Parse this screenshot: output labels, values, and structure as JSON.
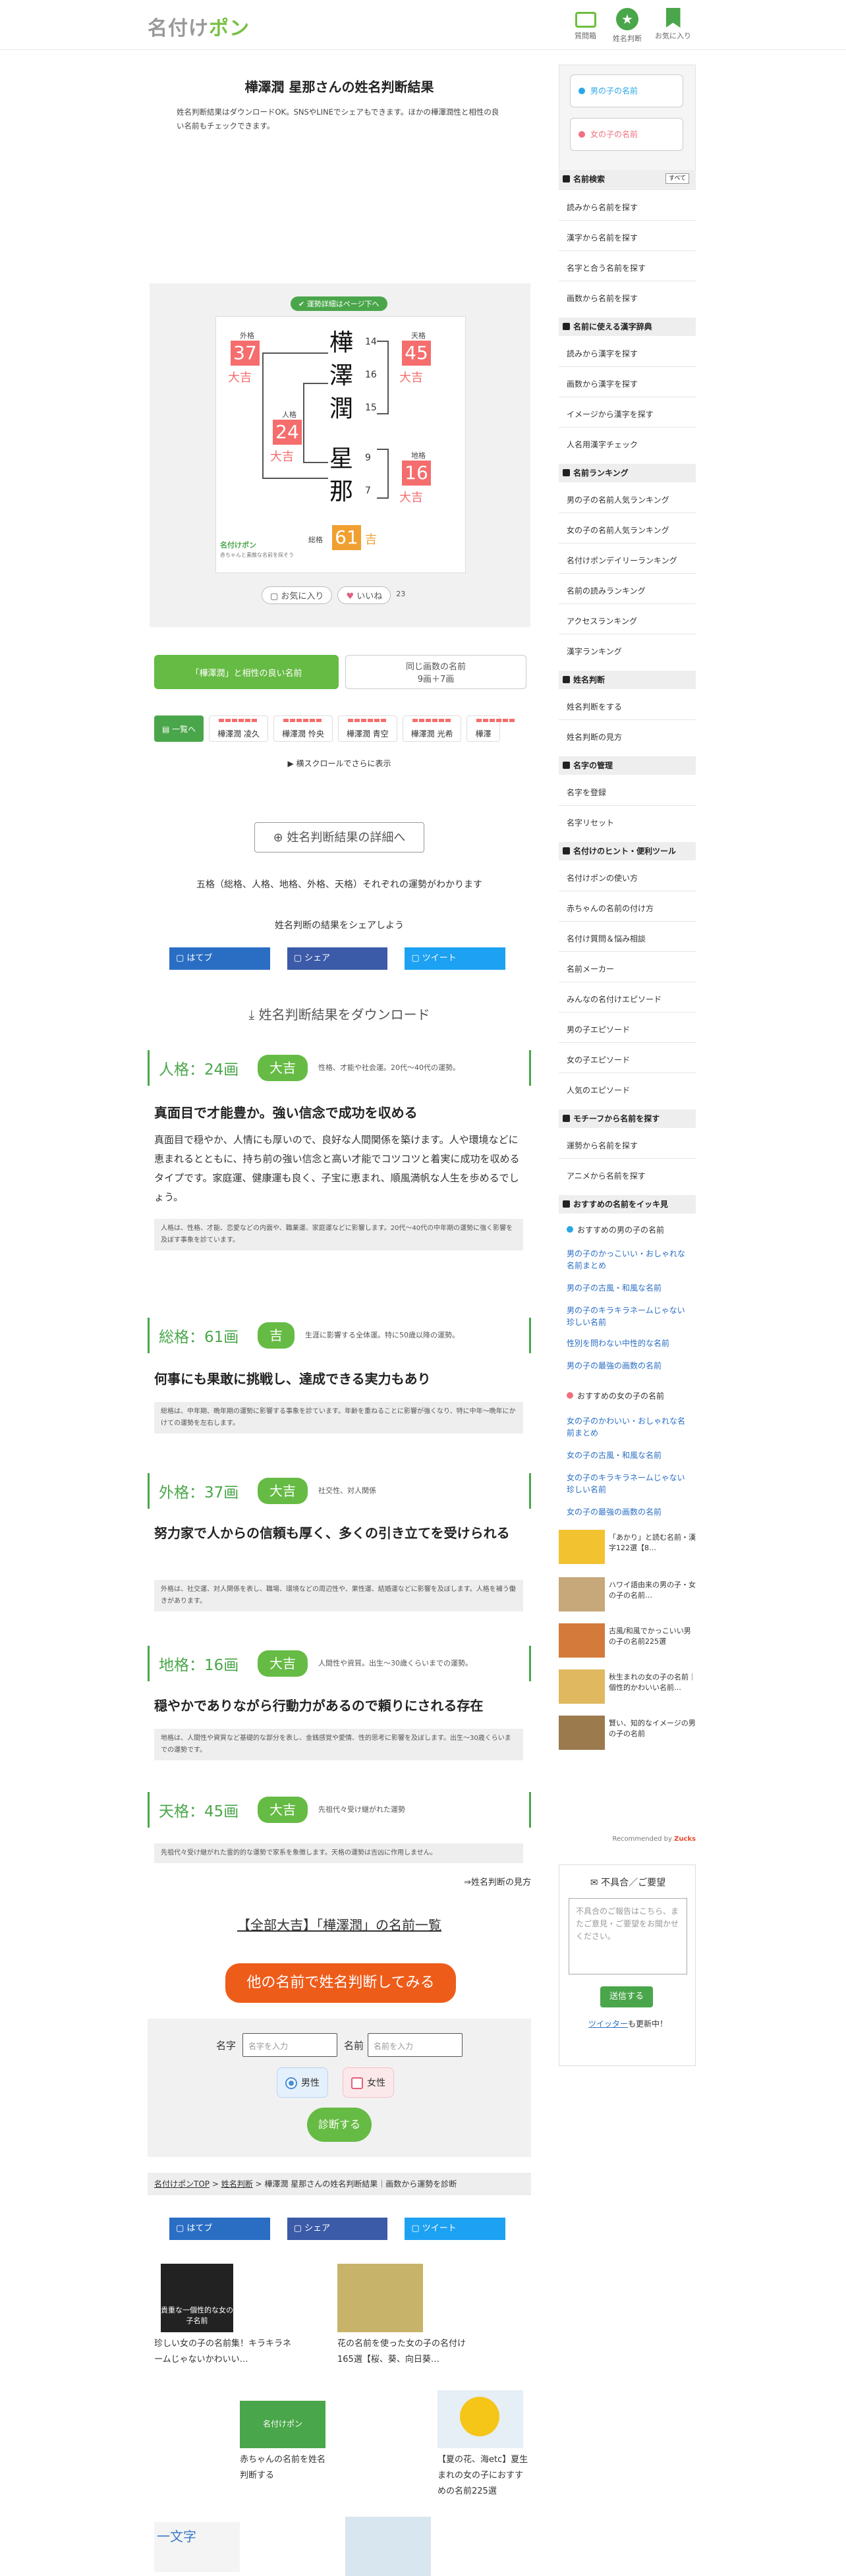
{
  "site": {
    "logo_a": "名付け",
    "logo_b": "ポン"
  },
  "header_nav": [
    {
      "label": "質問箱",
      "icon": "chat-icon",
      "color": "#6bbf3a"
    },
    {
      "label": "姓名判断",
      "icon": "star-icon",
      "color": "#4aa64a"
    },
    {
      "label": "お気に入り",
      "icon": "bookmark-icon",
      "color": "#4aa64a"
    }
  ],
  "page": {
    "title": "樺澤潤 星那さんの姓名判断結果",
    "lead": "姓名判断結果はダウンロードOK。SNSやLINEでシェアもできます。ほかの樺澤潤性と相性の良い名前もチェックできます。"
  },
  "figure": {
    "header": "運勢詳細はページ下へ",
    "surname": [
      "樺",
      "澤",
      "潤"
    ],
    "surname_strokes": [
      "14",
      "16",
      "15"
    ],
    "given": [
      "星",
      "那"
    ],
    "given_strokes": [
      "9",
      "7"
    ],
    "outer": {
      "label": "外格",
      "value": "37",
      "fortune": "大吉"
    },
    "person": {
      "label": "人格",
      "value": "24",
      "fortune": "大吉"
    },
    "heaven": {
      "label": "天格",
      "value": "45",
      "fortune": "大吉"
    },
    "earth": {
      "label": "地格",
      "value": "16",
      "fortune": "大吉"
    },
    "total": {
      "label": "総格",
      "value": "61",
      "fortune": "吉"
    },
    "brand": "名付けポン",
    "footer_small": "赤ちゃんと素敵な名前を探そう"
  },
  "actions": {
    "fav": "お気に入り",
    "like": "いいね",
    "count": "23"
  },
  "tabs": {
    "good": "「樺澤潤」と相性の良い名前",
    "same_a": "同じ画数の名前",
    "same_b": "9画＋7画"
  },
  "name_cards": {
    "first": "一覧へ",
    "items": [
      "樺澤潤 凌久",
      "樺澤潤 怜央",
      "樺澤潤 青空",
      "樺澤潤 光希",
      "樺澤"
    ]
  },
  "scroll_hint": "横スクロールでさらに表示",
  "detail_btn": "姓名判断結果の詳細へ",
  "detail_caption": "五格（総格、人格、地格、外格、天格）それぞれの運勢がわかります",
  "share_caption": "姓名判断の結果をシェアしよう",
  "share": {
    "hatena": "はてブ",
    "facebook": "シェア",
    "twitter": "ツイート"
  },
  "download": "姓名判断結果をダウンロード",
  "kaku": [
    {
      "head": "人格：24画",
      "tag": "大吉",
      "desc": "性格、才能や社会運。20代〜40代の運勢。",
      "title": "真面目で才能豊か。強い信念で成功を収める",
      "body": "真面目で穏やか、人情にも厚いので、良好な人間関係を築けます。人や環境などに恵まれるとともに、持ち前の強い信念と高い才能でコツコツと着実に成功を収めるタイプです。家庭運、健康運も良く、子宝に恵まれ、順風満帆な人生を歩めるでしょう。",
      "note": "人格は、性格、才能、恋愛などの内面や、職業運、家庭運などに影響します。20代〜40代の中年期の運勢に強く影響を及ぼす事象を診ています。"
    },
    {
      "head": "総格：61画",
      "tag": "吉",
      "desc": "生涯に影響する全体運。特に50歳以降の運勢。",
      "title": "何事にも果敢に挑戦し、達成できる実力もあり",
      "note": "総格は、中年期、晩年期の運勢に影響する事象を診ています。年齢を重ねることに影響が強くなり、特に中年〜晩年にかけての運勢を左右します。"
    },
    {
      "head": "外格：37画",
      "tag": "大吉",
      "desc": "社交性、対人関係",
      "title": "努力家で人からの信頼も厚く、多くの引き立てを受けられる",
      "note": "外格は、社交運、対人関係を表し、職場、環境などの周辺性や、果性運、結婚運などに影響を及ぼします。人格を補う働きがあります。"
    },
    {
      "head": "地格：16画",
      "tag": "大吉",
      "desc": "人間性や資質。出生〜30歳くらいまでの運勢。",
      "title": "穏やかでありながら行動力があるので頼りにされる存在",
      "note": "地格は、人間性や資質など基礎的な部分を表し、金銭感覚や愛情、性的思考に影響を及ぼします。出生〜30歳くらいまでの運勢です。"
    },
    {
      "head": "天格：45画",
      "tag": "大吉",
      "desc": "先祖代々受け継がれた運勢",
      "note": "先祖代々受け継がれた霊的的な運勢で家系を象徴します。天格の運勢は吉凶に作用しません。"
    }
  ],
  "kanji_link": "⇒姓名判断の見方",
  "allgood": "【全部大吉】「樺澤潤」の名前一覧",
  "bubble": "他の名前で姓名判断してみる",
  "form": {
    "sei_label": "名字",
    "sei_ph": "名字を入力",
    "mei_label": "名前",
    "mei_ph": "名前を入力",
    "male": "男性",
    "female": "女性",
    "submit": "診断する"
  },
  "crumb": {
    "a": "名付けポンTOP",
    "sep": " > ",
    "b": "姓名判断",
    "c": " > 樺澤潤 星那さんの姓名判断結果｜画数から運勢を診断"
  },
  "articles": [
    {
      "text": "珍しい女の子の名前集！キラキラネームじゃないかわいい…",
      "thumb": "貴重な一個性的な女の子名前"
    },
    {
      "text": "花の名前を使った女の子の名付け165選【桜、葵、向日葵…",
      "thumb": ""
    },
    {
      "text": "赤ちゃんの名前を姓名判断する",
      "thumb": "名付けポン"
    },
    {
      "text": "【夏の花、海etc】夏生まれの女の子におすすめの名前225選",
      "thumb": ""
    },
    {
      "text": "",
      "thumb": "一文字"
    },
    {
      "text": "",
      "thumb": ""
    }
  ],
  "sidebar": {
    "boy": "男の子の名前",
    "girl": "女の子の名前",
    "sections": [
      {
        "title": "名前検索",
        "badge": "すべて",
        "items": [
          "読みから名前を探す",
          "漢字から名前を探す",
          "名字と合う名前を探す",
          "画数から名前を探す"
        ]
      },
      {
        "title": "名前に使える漢字辞典",
        "items": [
          "読みから漢字を探す",
          "画数から漢字を探す",
          "イメージから漢字を探す",
          "人名用漢字チェック"
        ]
      },
      {
        "title": "名前ランキング",
        "items": [
          "男の子の名前人気ランキング",
          "女の子の名前人気ランキング",
          "名付けポンデイリーランキング",
          "名前の読みランキング",
          "アクセスランキング",
          "漢字ランキング"
        ]
      },
      {
        "title": "姓名判断",
        "items": [
          "姓名判断をする",
          "姓名判断の見方"
        ]
      },
      {
        "title": "名字の管理",
        "items": [
          "名字を登録",
          "名字リセット"
        ]
      },
      {
        "title": "名付けのヒント・便利ツール",
        "items": [
          "名付けポンの使い方",
          "赤ちゃんの名前の付け方",
          "名付け質問＆悩み相談",
          "名前メーカー",
          "みんなの名付けエピソード",
          "男の子エピソード",
          "女の子エピソード",
          "人気のエピソード"
        ]
      },
      {
        "title": "モチーフから名前を探す",
        "items": [
          "運勢から名前を探す",
          "アニメから名前を探す"
        ]
      },
      {
        "title": "おすすめの名前をイッキ見",
        "items": []
      }
    ],
    "rec_boy_head": "おすすめの男の子の名前",
    "rec_boy": [
      "男の子のかっこいい・おしゃれな名前まとめ",
      "男の子の古風・和風な名前",
      "男の子のキラキラネームじゃない珍しい名前",
      "性別を問わない中性的な名前",
      "男の子の最強の画数の名前"
    ],
    "rec_girl_head": "おすすめの女の子の名前",
    "rec_girl": [
      "女の子のかわいい・おしゃれな名前まとめ",
      "女の子の古風・和風な名前",
      "女の子のキラキラネームじゃない珍しい名前",
      "女の子の最強の画数の名前"
    ],
    "recommended": [
      "「あかり」と読む名前・漢字122選【8…",
      "ハワイ語由来の男の子・女の子の名前…",
      "古風/和風でかっこいい男の子の名前225選",
      "秋生まれの女の子の名前｜個性的かわいい名前…",
      "賢い、知的なイメージの男の子の名前"
    ],
    "recommended_by": "Recommended by",
    "feedback_title": "不具合／ご要望",
    "feedback_ph": "不具合のご報告はこちら、またご意見・ご要望をお聞かせください。",
    "feedback_send": "送信する",
    "twitter_a": "ツイッター",
    "twitter_b": "も更新中！"
  }
}
